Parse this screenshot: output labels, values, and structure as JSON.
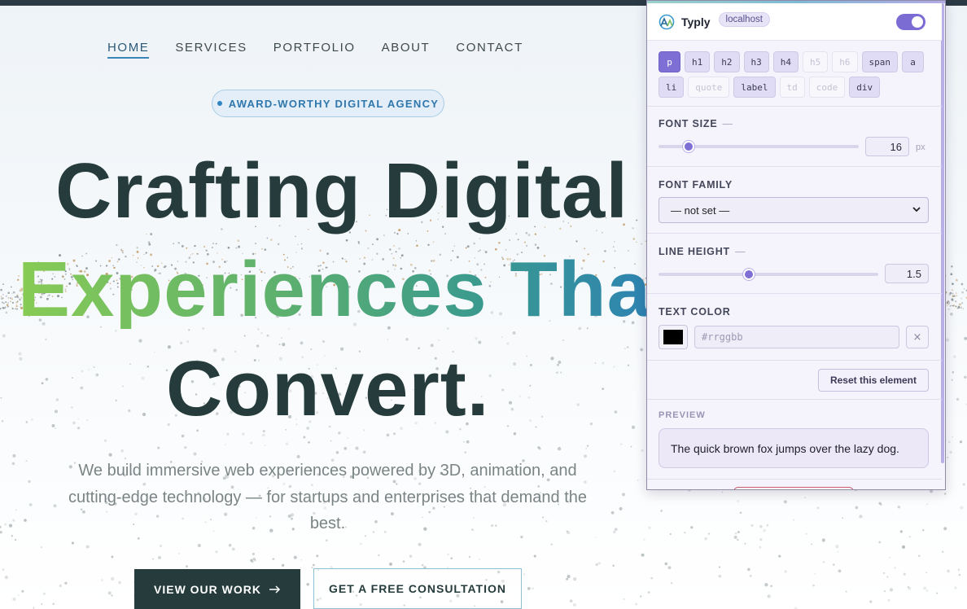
{
  "nav": {
    "items": [
      "HOME",
      "SERVICES",
      "PORTFOLIO",
      "ABOUT",
      "CONTACT"
    ],
    "active_index": 0
  },
  "badge": {
    "text": "AWARD-WORTHY DIGITAL AGENCY"
  },
  "hero": {
    "line1": "Crafting Digital",
    "line2": "Experiences That",
    "line3": "Convert.",
    "subtext": "We build immersive web experiences powered by 3D, animation, and cutting-edge technology — for startups and enterprises that demand the best."
  },
  "buttons": {
    "primary_label": "VIEW OUR WORK",
    "primary_icon": "arrow-right-icon",
    "secondary_label": "GET A FREE CONSULTATION"
  },
  "colors": {
    "ink": "#263b3b",
    "gradient": [
      "#88cb55",
      "#2c80b8"
    ],
    "panel_accent": "#7e6fd4"
  },
  "panel": {
    "brand": "Typly",
    "host": "localhost",
    "enabled": true,
    "tags": [
      {
        "label": "p",
        "state": "active"
      },
      {
        "label": "h1",
        "state": "on"
      },
      {
        "label": "h2",
        "state": "on"
      },
      {
        "label": "h3",
        "state": "on"
      },
      {
        "label": "h4",
        "state": "on"
      },
      {
        "label": "h5",
        "state": "dim"
      },
      {
        "label": "h6",
        "state": "dim"
      },
      {
        "label": "span",
        "state": "on"
      },
      {
        "label": "a",
        "state": "on"
      },
      {
        "label": "li",
        "state": "on"
      },
      {
        "label": "quote",
        "state": "dim"
      },
      {
        "label": "label",
        "state": "on"
      },
      {
        "label": "td",
        "state": "dim"
      },
      {
        "label": "code",
        "state": "dim"
      },
      {
        "label": "div",
        "state": "on"
      }
    ],
    "font_size": {
      "title": "FONT SIZE",
      "dash": "—",
      "value": "16",
      "unit": "px",
      "slider_fraction": 0.15
    },
    "font_family": {
      "title": "FONT FAMILY",
      "selected": "— not set —"
    },
    "line_height": {
      "title": "LINE HEIGHT",
      "dash": "—",
      "value": "1.5",
      "slider_fraction": 0.41
    },
    "text_color": {
      "title": "TEXT COLOR",
      "swatch": "#000000",
      "placeholder": "#rrggbb",
      "clear": "×"
    },
    "reset_label": "Reset this element",
    "preview": {
      "title": "PREVIEW",
      "text": "The quick brown fox jumps over the lazy dog."
    }
  }
}
